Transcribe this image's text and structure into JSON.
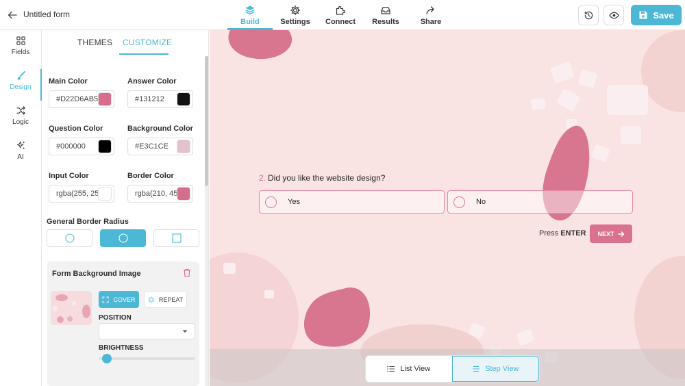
{
  "header": {
    "form_title": "Untitled form",
    "nav": [
      {
        "label": "Build",
        "icon": "stack-icon",
        "active": true
      },
      {
        "label": "Settings",
        "icon": "gear-icon",
        "active": false
      },
      {
        "label": "Connect",
        "icon": "puzzle-icon",
        "active": false
      },
      {
        "label": "Results",
        "icon": "inbox-icon",
        "active": false
      },
      {
        "label": "Share",
        "icon": "share-icon",
        "active": false
      }
    ],
    "save_label": "Save"
  },
  "rail": {
    "items": [
      {
        "label": "Fields",
        "icon": "grid-icon"
      },
      {
        "label": "Design",
        "icon": "brush-icon",
        "active": true
      },
      {
        "label": "Logic",
        "icon": "shuffle-icon"
      },
      {
        "label": "AI",
        "icon": "sparkle-icon"
      }
    ]
  },
  "panel": {
    "tabs": {
      "themes": "THEMES",
      "customize": "CUSTOMIZE"
    },
    "colors": {
      "main": {
        "label": "Main Color",
        "value": "#D22D6AB5",
        "swatch": "#d56d8d"
      },
      "answer": {
        "label": "Answer Color",
        "value": "#131212",
        "swatch": "#131212"
      },
      "question": {
        "label": "Question Color",
        "value": "#000000",
        "swatch": "#000000"
      },
      "background": {
        "label": "Background Color",
        "value": "#E3C1CE",
        "swatch": "#e3c1ce"
      },
      "input": {
        "label": "Input Color",
        "value": "rgba(255, 25",
        "swatch": "#ffffff"
      },
      "border": {
        "label": "Border Color",
        "value": "rgba(210, 45",
        "swatch": "#d56d8d"
      }
    },
    "border_radius": {
      "label": "General Border Radius",
      "selected": "rounded"
    },
    "background_image": {
      "title": "Form Background Image",
      "cover_label": "COVER",
      "repeat_label": "REPEAT",
      "position_label": "POSITION",
      "position_value": "",
      "brightness_label": "BRIGHTNESS",
      "brightness": 0.06
    }
  },
  "preview": {
    "question_number": "2.",
    "question_text": "Did you like the website design?",
    "answers": [
      "Yes",
      "No"
    ],
    "press_text": "Press",
    "press_key": "ENTER",
    "next_label": "NEXT"
  },
  "view_toggle": {
    "list_label": "List View",
    "step_label": "Step View",
    "selected": "step"
  },
  "colors": {
    "accent": "#4cb8d6",
    "brand_pink": "#d9728e",
    "canvas_bg": "#f9e4e3"
  }
}
